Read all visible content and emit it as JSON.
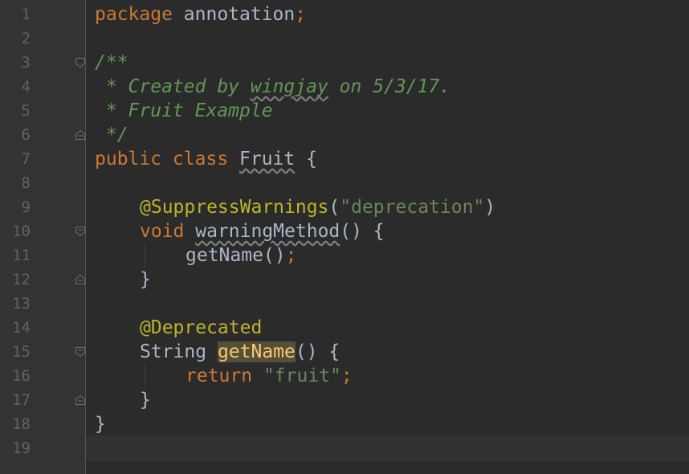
{
  "editor": {
    "line_numbers": [
      "1",
      "2",
      "3",
      "4",
      "5",
      "6",
      "7",
      "8",
      "9",
      "10",
      "11",
      "12",
      "13",
      "14",
      "15",
      "16",
      "17",
      "18",
      "19"
    ],
    "code": {
      "l1": {
        "kw": "package",
        "name": " annotation",
        "semi": ";"
      },
      "l3": {
        "doc": "/**"
      },
      "l4": {
        "pre": " * Created by ",
        "author": "wingjay",
        "post": " on 5/3/17."
      },
      "l5": {
        "doc": " * Fruit Example"
      },
      "l6": {
        "doc": " */"
      },
      "l7": {
        "kw": "public class ",
        "cls": "Fruit",
        "rest": " {"
      },
      "l9": {
        "ann": "@SuppressWarnings",
        "open": "(",
        "str": "\"deprecation\"",
        "close": ")"
      },
      "l10": {
        "kw": "void ",
        "method": "warningMethod",
        "rest": "() {"
      },
      "l11": {
        "call": "getName()",
        "semi": ";"
      },
      "l12": {
        "text": "}"
      },
      "l14": {
        "ann": "@Deprecated"
      },
      "l15": {
        "type": "String ",
        "method": "getName",
        "rest": "() {"
      },
      "l16": {
        "kw": "return ",
        "str": "\"fruit\"",
        "semi": ";"
      },
      "l17": {
        "text": "}"
      },
      "l18": {
        "text": "}"
      }
    },
    "colors": {
      "background": "#2b2b2b",
      "gutter": "#313335",
      "keyword": "#cc7832",
      "doc_comment": "#629755",
      "annotation": "#bbb529",
      "string": "#6a8759",
      "identifier": "#a9b7c6",
      "usage_highlight": "#52503a"
    }
  }
}
